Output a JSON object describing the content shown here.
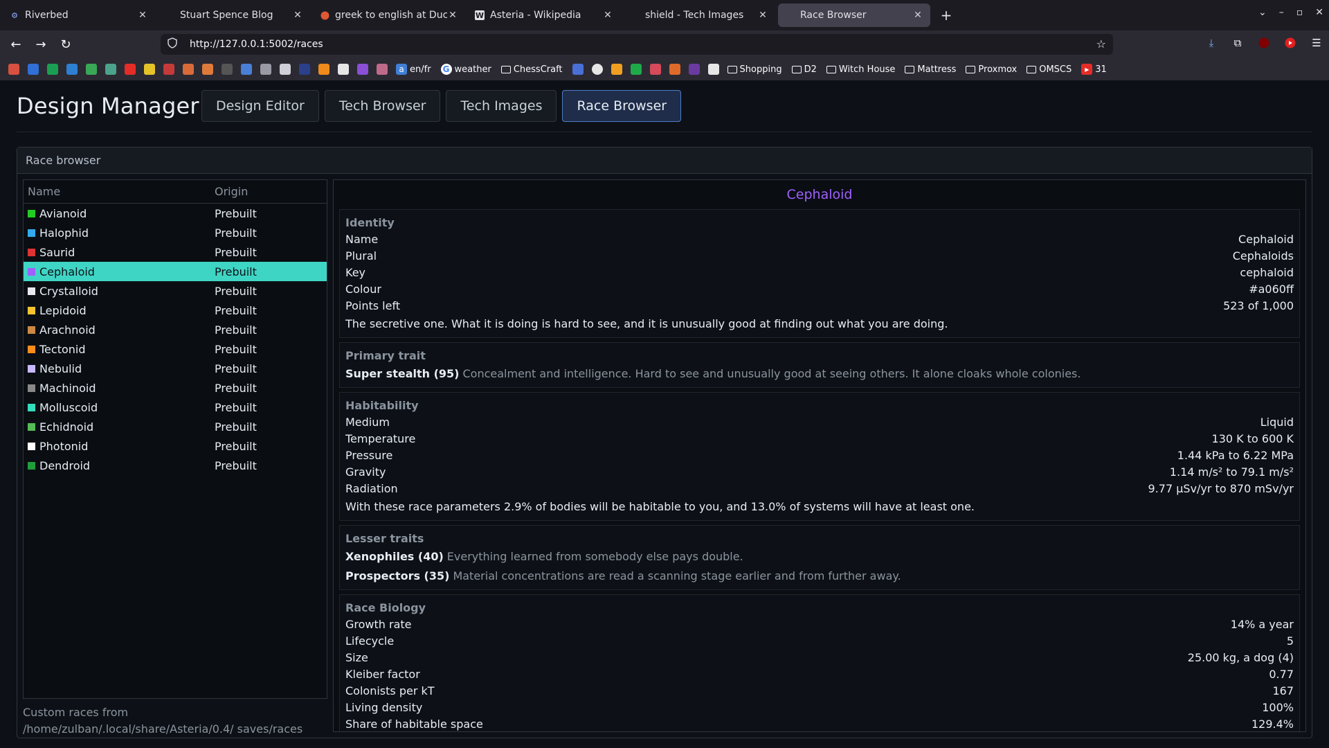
{
  "browser": {
    "tabs": [
      {
        "label": "Riverbed",
        "active": false
      },
      {
        "label": "Stuart Spence Blog",
        "active": false
      },
      {
        "label": "greek to english at DuckDu",
        "active": false
      },
      {
        "label": "Asteria - Wikipedia",
        "active": false
      },
      {
        "label": "shield - Tech Images",
        "active": false
      },
      {
        "label": "Race Browser",
        "active": true
      }
    ],
    "url": "http://127.0.0.1:5002/races",
    "bookmarks": {
      "enfr": "en/fr",
      "weather": "weather",
      "chesscraft": "ChessCraft",
      "shopping": "Shopping",
      "d2": "D2",
      "witch_house": "Witch House",
      "mattress": "Mattress",
      "proxmox": "Proxmox",
      "omscs": "OMSCS",
      "yt31": "31"
    }
  },
  "app": {
    "title": "Design Manager",
    "nav": [
      {
        "label": "Design Editor",
        "active": false
      },
      {
        "label": "Tech Browser",
        "active": false
      },
      {
        "label": "Tech Images",
        "active": false
      },
      {
        "label": "Race Browser",
        "active": true
      }
    ],
    "panel_title": "Race browser",
    "list": {
      "headers": [
        "Name",
        "Origin"
      ],
      "rows": [
        {
          "name": "Avianoid",
          "origin": "Prebuilt",
          "color": "#22cc22"
        },
        {
          "name": "Halophid",
          "origin": "Prebuilt",
          "color": "#33aaee"
        },
        {
          "name": "Saurid",
          "origin": "Prebuilt",
          "color": "#dd3333"
        },
        {
          "name": "Cephaloid",
          "origin": "Prebuilt",
          "color": "#a060ff",
          "selected": true
        },
        {
          "name": "Crystalloid",
          "origin": "Prebuilt",
          "color": "#e8e8f0"
        },
        {
          "name": "Lepidoid",
          "origin": "Prebuilt",
          "color": "#f2c230"
        },
        {
          "name": "Arachnoid",
          "origin": "Prebuilt",
          "color": "#cc8844"
        },
        {
          "name": "Tectonid",
          "origin": "Prebuilt",
          "color": "#ff8c1a"
        },
        {
          "name": "Nebulid",
          "origin": "Prebuilt",
          "color": "#c8b8ff"
        },
        {
          "name": "Machinoid",
          "origin": "Prebuilt",
          "color": "#888888"
        },
        {
          "name": "Molluscoid",
          "origin": "Prebuilt",
          "color": "#33ddbb"
        },
        {
          "name": "Echidnoid",
          "origin": "Prebuilt",
          "color": "#55bb55"
        },
        {
          "name": "Photonid",
          "origin": "Prebuilt",
          "color": "#ffffff"
        },
        {
          "name": "Dendroid",
          "origin": "Prebuilt",
          "color": "#1f9e3a"
        }
      ],
      "footer": "Custom races from /home/zulban/.local/share/Asteria/0.4/ saves/races"
    },
    "detail": {
      "title": "Cephaloid",
      "identity": {
        "heading": "Identity",
        "rows": [
          {
            "k": "Name",
            "v": "Cephaloid"
          },
          {
            "k": "Plural",
            "v": "Cephaloids"
          },
          {
            "k": "Key",
            "v": "cephaloid"
          },
          {
            "k": "Colour",
            "v": "#a060ff"
          },
          {
            "k": "Points left",
            "v": "523 of 1,000"
          }
        ],
        "description": "The secretive one. What it is doing is hard to see, and it is unusually good at finding out what you are doing."
      },
      "primary": {
        "heading": "Primary trait",
        "name": "Super stealth (95)",
        "text": "Concealment and intelligence. Hard to see and unusually good at seeing others. It alone cloaks whole colonies."
      },
      "habitability": {
        "heading": "Habitability",
        "rows": [
          {
            "k": "Medium",
            "v": "Liquid"
          },
          {
            "k": "Temperature",
            "v": "130 K to 600 K"
          },
          {
            "k": "Pressure",
            "v": "1.44 kPa to 6.22 MPa"
          },
          {
            "k": "Gravity",
            "v": "1.14 m/s² to 79.1 m/s²"
          },
          {
            "k": "Radiation",
            "v": "9.77 µSv/yr to 870 mSv/yr"
          }
        ],
        "note": "With these race parameters 2.9% of bodies will be habitable to you, and 13.0% of systems will have at least one."
      },
      "lesser": {
        "heading": "Lesser traits",
        "traits": [
          {
            "name": "Xenophiles (40)",
            "text": "Everything learned from somebody else pays double."
          },
          {
            "name": "Prospectors (35)",
            "text": "Material concentrations are read a scanning stage earlier and from further away."
          }
        ]
      },
      "biology": {
        "heading": "Race Biology",
        "rows": [
          {
            "k": "Growth rate",
            "v": "14% a year"
          },
          {
            "k": "Lifecycle",
            "v": "5"
          },
          {
            "k": "Size",
            "v": "25.00 kg, a dog (4)"
          },
          {
            "k": "Kleiber factor",
            "v": "0.77"
          },
          {
            "k": "Colonists per kT",
            "v": "167"
          },
          {
            "k": "Living density",
            "v": "100%"
          },
          {
            "k": "Share of habitable space",
            "v": "129.4%"
          }
        ]
      }
    }
  }
}
